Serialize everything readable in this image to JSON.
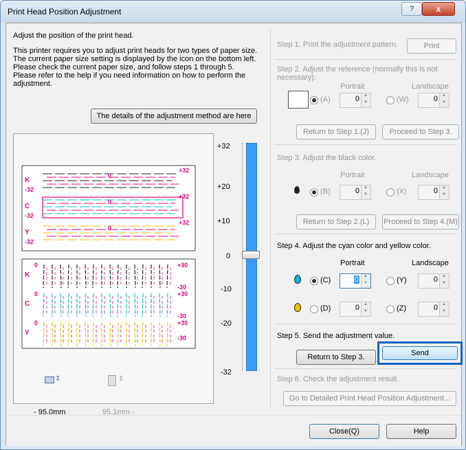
{
  "window": {
    "title": "Print Head Position Adjustment",
    "help_symbol": "?",
    "close_symbol": "x"
  },
  "intro": {
    "line1": "Adjust the position of the print head.",
    "line2": "This printer requires you to adjust print heads for two types of paper size.",
    "line3": "The current paper size setting is displayed by the icon on the bottom left.",
    "line4": "Please check the current paper size, and follow steps 1 through 5.",
    "line5": "Please refer to the help if you need information on how to perform the",
    "line6": "adjustment."
  },
  "details_button": "The details of the adjustment method are here",
  "slider": {
    "ticks": [
      "+32",
      "+20",
      "+10",
      "0",
      "-10",
      "-20",
      "-32"
    ],
    "value": 0
  },
  "pattern_top": {
    "rows": [
      "K",
      "C",
      "Y"
    ],
    "plus": "+32",
    "minus": "-32",
    "zero": "0"
  },
  "pattern_bottom": {
    "rows": [
      "K",
      "C",
      "Y"
    ],
    "plus": "+30",
    "minus": "-30",
    "zero": "0"
  },
  "paper": {
    "left_value": "- 95.0mm",
    "right_value": "95.1mm -"
  },
  "step1": {
    "label": "Step 1. Print the adjustment pattern.",
    "button": "Print"
  },
  "step2": {
    "label_line1": "Step 2. Adjust the reference (normally this is not",
    "label_line2": "necessary).",
    "portrait": "Portrait",
    "landscape": "Landscape",
    "radio_a": "(A)",
    "radio_w": "(W)",
    "value_a": "0",
    "value_w": "0",
    "return_button": "Return to Step 1.(J)",
    "proceed_button": "Proceed to Step 3."
  },
  "step3": {
    "label": "Step 3. Adjust the black color.",
    "portrait": "Portrait",
    "landscape": "Landscape",
    "radio_b": "(B)",
    "radio_x": "(X)",
    "value_b": "0",
    "value_x": "0",
    "return_button": "Return to Step 2.(L)",
    "proceed_button": "Proceed to Step 4.(M)"
  },
  "step4": {
    "label": "Step 4. Adjust the cyan color and yellow color.",
    "portrait": "Portrait",
    "landscape": "Landscape",
    "radio_c": "(C)",
    "radio_y": "(Y)",
    "radio_d": "(D)",
    "radio_z": "(Z)",
    "value_c": "0",
    "value_y": "0",
    "value_d": "0",
    "value_z": "0"
  },
  "step5": {
    "label": "Step 5. Send the adjustment value.",
    "return_button": "Return to Step 3.",
    "send_button": "Send"
  },
  "step6": {
    "label": "Step 6. Check the adjustment result.",
    "button": "Go to Detailed Print Head Position Adjustment..."
  },
  "footer": {
    "close_button": "Close(Q)",
    "help_button": "Help"
  },
  "colors": {
    "black": "#222222",
    "cyan": "#00bcd4",
    "magenta": "#e4007f",
    "yellow": "#f2c200",
    "highlight": "#1565c0",
    "slider": "#3a9cf0"
  }
}
